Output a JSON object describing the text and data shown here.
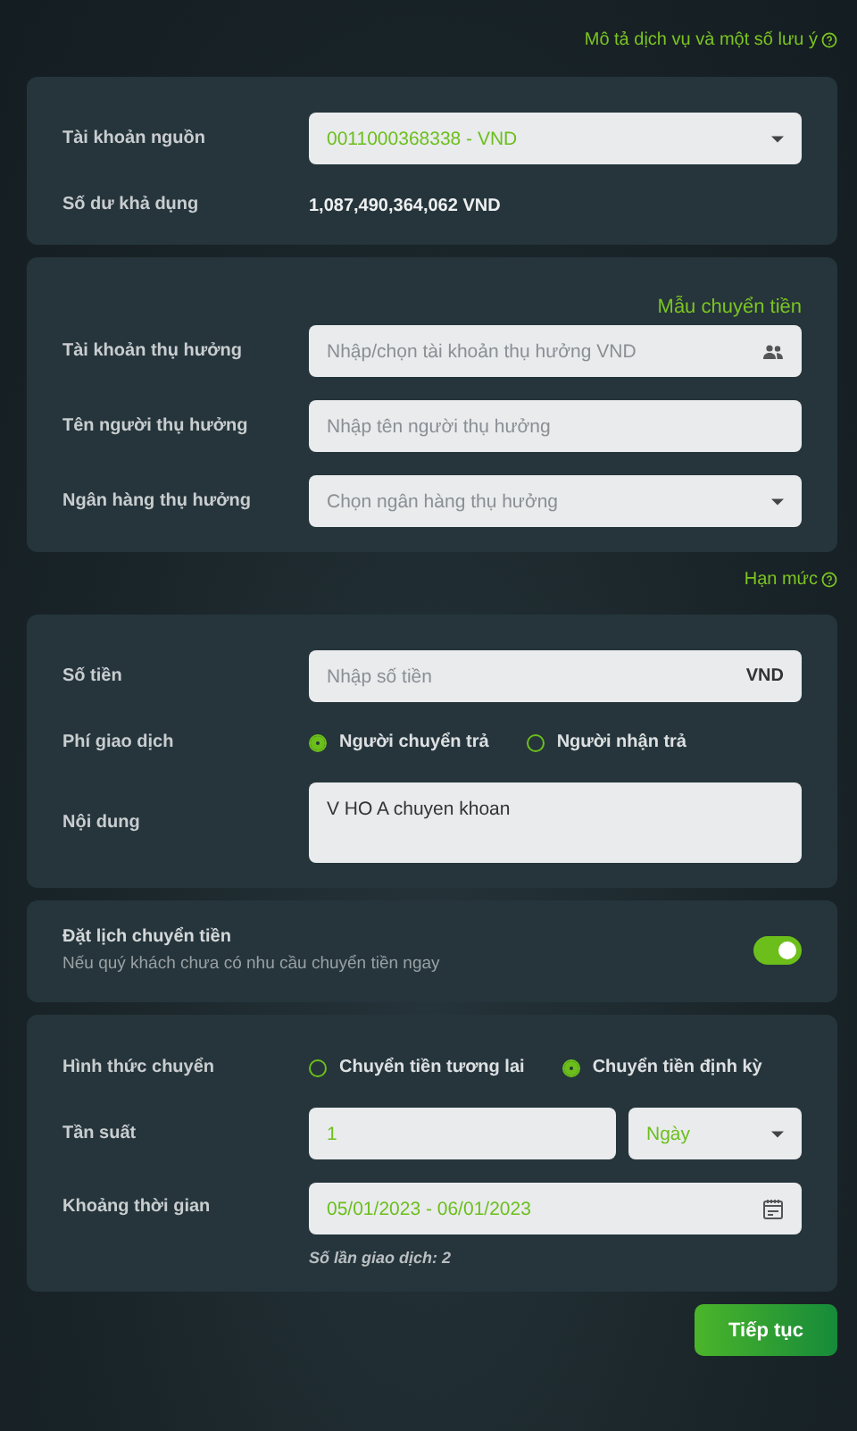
{
  "top_link": "Mô tả dịch vụ và một số lưu ý",
  "cards": [
    {
      "rows": [
        {
          "kind": "select",
          "label": "Tài khoản nguồn",
          "value": "0011000368338 - VND"
        },
        {
          "kind": "static",
          "label": "Số dư khả dụng",
          "value": "1,087,490,364,062 VND"
        }
      ]
    },
    {
      "link": "Mẫu chuyển tiền",
      "rows": [
        {
          "kind": "lookup",
          "label": "Tài khoản thụ hưởng",
          "placeholder": "Nhập/chọn tài khoản thụ hưởng VND"
        },
        {
          "kind": "input",
          "label": "Tên người thụ hưởng",
          "placeholder": "Nhập tên người thụ hưởng"
        },
        {
          "kind": "select",
          "label": "Ngân hàng thụ hưởng",
          "placeholder": "Chọn ngân hàng thụ hưởng"
        }
      ]
    },
    {
      "link_above": "Hạn mức",
      "rows": [
        {
          "kind": "input",
          "label": "Số tiền",
          "placeholder": "Nhập số tiền",
          "suffix": "VND"
        },
        {
          "kind": "radio",
          "label": "Phí giao dịch",
          "options": [
            {
              "label": "Người chuyển trả",
              "selected": true
            },
            {
              "label": "Người nhận trả",
              "selected": false
            }
          ]
        },
        {
          "kind": "textarea",
          "label": "Nội dung",
          "value": "V HO A chuyen khoan"
        }
      ]
    },
    {
      "rows": [
        {
          "kind": "toggle",
          "label": "Đặt lịch chuyển tiền",
          "subtitle": "Nếu quý khách chưa có nhu cầu chuyển tiền ngay",
          "on": true
        }
      ]
    },
    {
      "rows": [
        {
          "kind": "radio",
          "label": "Hình thức chuyển",
          "options": [
            {
              "label": "Chuyển tiền tương lai",
              "selected": false
            },
            {
              "label": "Chuyển tiền định kỳ",
              "selected": true
            }
          ]
        },
        {
          "kind": "split",
          "label": "Tần suất",
          "value": "1",
          "unit": "Ngày"
        },
        {
          "kind": "date",
          "label": "Khoảng thời gian",
          "value": "05/01/2023 - 06/01/2023",
          "note": "Số lần giao dịch: 2"
        }
      ]
    }
  ],
  "button": "Tiếp tục"
}
